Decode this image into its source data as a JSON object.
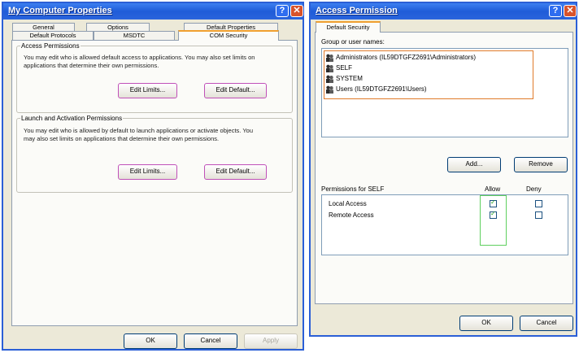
{
  "left_window": {
    "title": "My Computer Properties",
    "help_glyph": "?",
    "close_glyph": "✕",
    "tabs_row1": [
      "General",
      "Options",
      "Default Properties"
    ],
    "tabs_row2": [
      "Default Protocols",
      "MSDTC",
      "COM Security"
    ],
    "access_permissions": {
      "legend": "Access Permissions",
      "description": "You may edit who is allowed default access to applications. You may also set limits on applications that determine their own permissions.",
      "edit_limits": "Edit Limits...",
      "edit_default": "Edit Default..."
    },
    "launch_permissions": {
      "legend": "Launch and Activation Permissions",
      "description": "You may edit who is allowed by default to launch applications or activate objects. You may also set limits on applications that determine their own permissions.",
      "edit_limits": "Edit Limits...",
      "edit_default": "Edit Default..."
    },
    "ok": "OK",
    "cancel": "Cancel",
    "apply": "Apply"
  },
  "right_window": {
    "title": "Access Permission",
    "help_glyph": "?",
    "close_glyph": "✕",
    "tab": "Default Security",
    "group_label": "Group or user names:",
    "users": [
      "Administrators (IL59DTGFZ2691\\Administrators)",
      "SELF",
      "SYSTEM",
      "Users (IL59DTGFZ2691\\Users)"
    ],
    "add": "Add...",
    "remove": "Remove",
    "permissions_label": "Permissions for SELF",
    "allow_header": "Allow",
    "deny_header": "Deny",
    "permissions": [
      {
        "name": "Local Access",
        "allow": true,
        "deny": false
      },
      {
        "name": "Remote Access",
        "allow": true,
        "deny": false
      }
    ],
    "ok": "OK",
    "cancel": "Cancel"
  },
  "colors": {
    "titlebar": "#1f5cd8",
    "window_body": "#ece9d8",
    "highlight_pink": "#c050b8",
    "highlight_orange": "#e07b2a",
    "highlight_green": "#5fcf5f",
    "active_tab_accent": "#f0a030"
  }
}
